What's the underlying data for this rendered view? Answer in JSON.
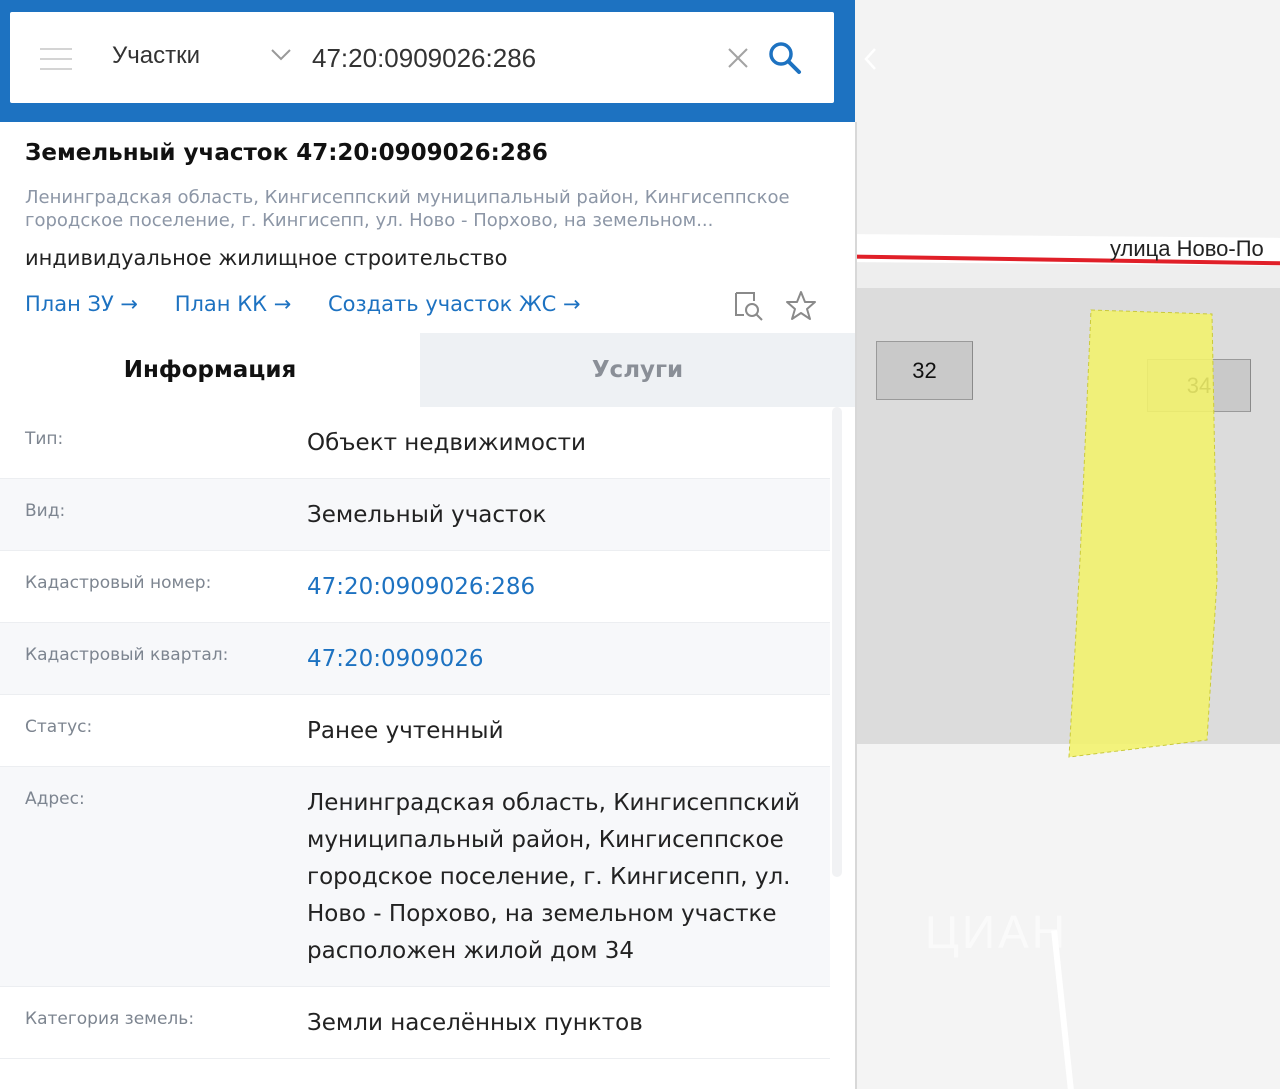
{
  "search": {
    "layer_label": "Участки",
    "query_value": "47:20:0909026:286"
  },
  "card": {
    "title": "Земельный участок 47:20:0909026:286",
    "address_short": "Ленинградская область, Кингисеппский муниципальный район, Кингисеппское городское поселение, г. Кингисепп, ул. Ново - Порхово, на земельном...",
    "purpose": "индивидуальное жилищное строительство",
    "links": [
      {
        "label": "План ЗУ →"
      },
      {
        "label": "План КК →"
      },
      {
        "label": "Создать участок ЖС →"
      }
    ]
  },
  "tabs": [
    {
      "label": "Информация",
      "active": true
    },
    {
      "label": "Услуги",
      "active": false
    }
  ],
  "rows": [
    {
      "label": "Тип:",
      "value": "Объект недвижимости"
    },
    {
      "label": "Вид:",
      "value": "Земельный участок"
    },
    {
      "label": "Кадастровый номер:",
      "value": "47:20:0909026:286"
    },
    {
      "label": "Кадастровый квартал:",
      "value": "47:20:0909026"
    },
    {
      "label": "Статус:",
      "value": "Ранее учтенный"
    },
    {
      "label": "Адрес:",
      "value": "Ленинградская область, Кингисеппский муниципальный район, Кингисеппское городское поселение, г. Кингисепп, ул. Ново - Порхово, на земельном участке расположен жилой дом 34"
    },
    {
      "label": "Категория земель:",
      "value": "Земли населённых пунктов"
    }
  ],
  "map": {
    "street_label": "улица Ново-По",
    "house_numbers": [
      "32",
      "34"
    ],
    "watermark": "ЦИАН",
    "plot_color": "#f2f26b",
    "road_color": "#e01f28"
  },
  "colors": {
    "accent": "#1d72c1"
  }
}
